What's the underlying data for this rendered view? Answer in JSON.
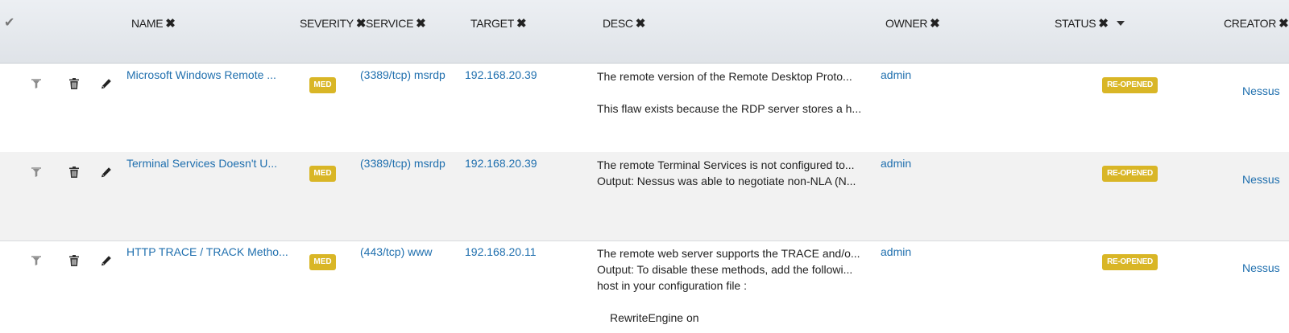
{
  "header": {
    "check_icon": "check-icon",
    "columns": {
      "name": "NAME",
      "severity": "SEVERITY",
      "service": "SERVICE",
      "target": "TARGET",
      "desc": "DESC",
      "owner": "OWNER",
      "status": "STATUS",
      "creator": "CREATOR"
    },
    "remove_glyph": "✖"
  },
  "rows": [
    {
      "name": "Microsoft Windows Remote ...",
      "severity": "MED",
      "service": "(3389/tcp) msrdp",
      "target": "192.168.20.39",
      "desc": {
        "line1": "The remote version of the Remote Desktop Proto...",
        "line2": "This flaw exists because the RDP server stores a h..."
      },
      "owner": "admin",
      "status": "RE-OPENED",
      "creator": "Nessus"
    },
    {
      "name": "Terminal Services Doesn't U...",
      "severity": "MED",
      "service": "(3389/tcp) msrdp",
      "target": "192.168.20.39",
      "desc": {
        "line1": "The remote Terminal Services is not configured to...",
        "line2": "Output: Nessus was able to negotiate non-NLA (N..."
      },
      "owner": "admin",
      "status": "RE-OPENED",
      "creator": "Nessus"
    },
    {
      "name": "HTTP TRACE / TRACK Metho...",
      "severity": "MED",
      "service": "(443/tcp) www",
      "target": "192.168.20.11",
      "desc": {
        "line1": "The remote web server supports the TRACE and/o...",
        "line2": "Output: To disable these methods, add the followi...",
        "line3": "host in your configuration file :",
        "line4": "RewriteEngine on"
      },
      "owner": "admin",
      "status": "RE-OPENED",
      "creator": "Nessus"
    }
  ],
  "colors": {
    "link": "#1f6fae",
    "badge": "#d9b626",
    "alt_row": "#f2f2f2"
  }
}
